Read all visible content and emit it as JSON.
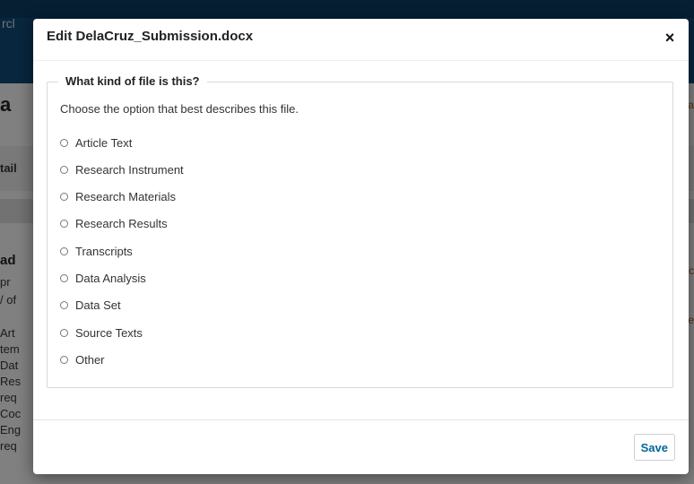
{
  "background": {
    "site_title_fragment": "rcl",
    "page_title_fragment": "a",
    "tab_fragment": "tail",
    "section_fragment": "ad",
    "text_fragments": [
      "pr",
      "/ of",
      "Art",
      "tem",
      "Dat",
      "Res",
      "req",
      "Coc",
      "Eng",
      "req"
    ],
    "right_fragments": [
      "a",
      "c",
      "e"
    ]
  },
  "modal": {
    "title": "Edit DelaCruz_Submission.docx",
    "close_label": "×",
    "legend": "What kind of file is this?",
    "help_text": "Choose the option that best describes this file.",
    "options": [
      {
        "label": "Article Text"
      },
      {
        "label": "Research Instrument"
      },
      {
        "label": "Research Materials"
      },
      {
        "label": "Research Results"
      },
      {
        "label": "Transcripts"
      },
      {
        "label": "Data Analysis"
      },
      {
        "label": "Data Set"
      },
      {
        "label": "Source Texts"
      },
      {
        "label": "Other"
      }
    ],
    "save_label": "Save"
  },
  "colors": {
    "header": "#0f4672",
    "accent": "#006798"
  }
}
